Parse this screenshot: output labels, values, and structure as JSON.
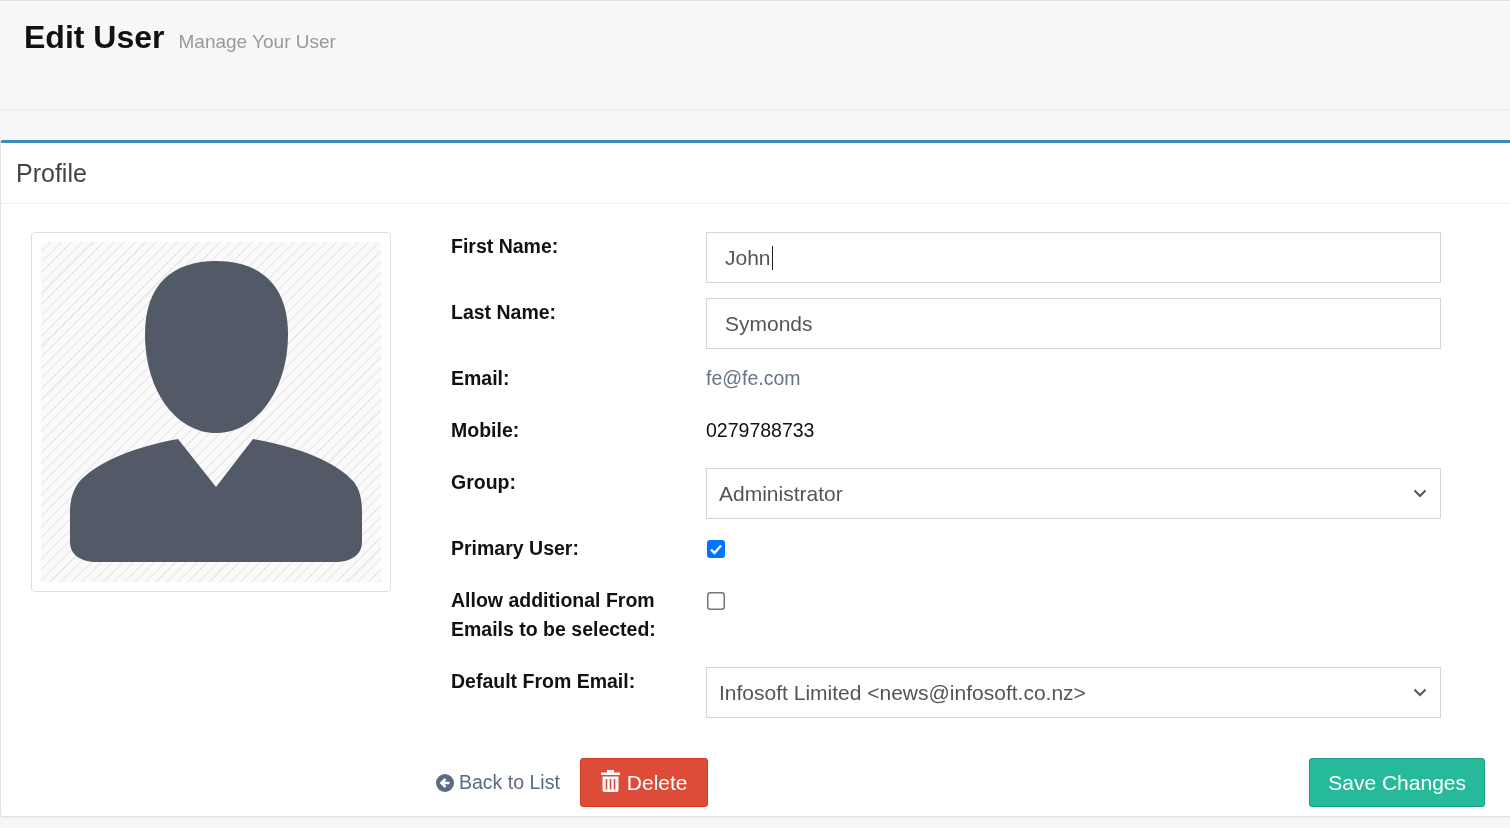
{
  "page_header": {
    "title": "Edit User",
    "subtitle": "Manage Your User"
  },
  "panel": {
    "title": "Profile"
  },
  "form": {
    "fields": [
      {
        "kind": "text_input",
        "label": "First Name:",
        "value": "John",
        "focused": true
      },
      {
        "kind": "text_input",
        "label": "Last Name:",
        "value": "Symonds",
        "focused": false
      },
      {
        "kind": "muted_text",
        "label": "Email:",
        "value": "fe@fe.com"
      },
      {
        "kind": "text",
        "label": "Mobile:",
        "value": "0279788733"
      },
      {
        "kind": "select",
        "label": "Group:",
        "value": "Administrator"
      },
      {
        "kind": "checkbox",
        "label": "Primary User:",
        "checked": true
      },
      {
        "kind": "checkbox",
        "label": "Allow additional From Emails to be selected:",
        "checked": false
      },
      {
        "kind": "select",
        "label": "Default From Email:",
        "value": "Infosoft Limited <news@infosoft.co.nz>"
      }
    ]
  },
  "actions": [
    {
      "kind": "link",
      "label": "Back to List"
    },
    {
      "kind": "danger",
      "label": "Delete"
    },
    {
      "kind": "primary",
      "label": "Save Changes"
    }
  ]
}
